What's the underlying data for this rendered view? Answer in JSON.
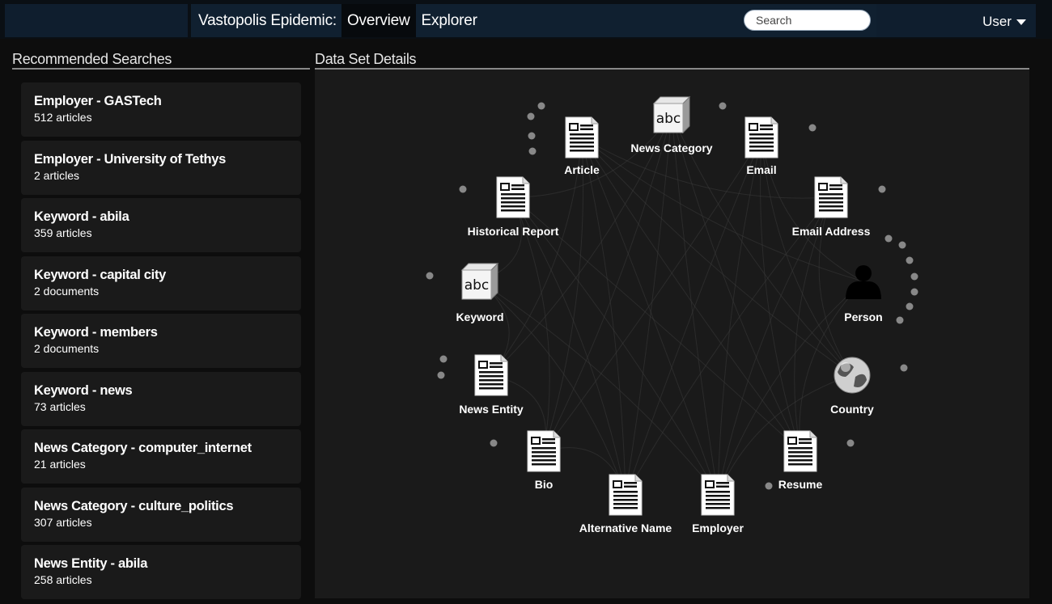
{
  "header": {
    "app_title": "Vastopolis Epidemic:",
    "tabs": [
      {
        "label": "Overview",
        "active": true
      },
      {
        "label": "Explorer",
        "active": false
      }
    ],
    "search_placeholder": "Search",
    "user_label": "User"
  },
  "left_panel": {
    "title": "Recommended Searches",
    "items": [
      {
        "title": "Employer - GASTech",
        "subtitle": "512 articles"
      },
      {
        "title": "Employer - University of Tethys",
        "subtitle": "2 articles"
      },
      {
        "title": "Keyword - abila",
        "subtitle": "359 articles"
      },
      {
        "title": "Keyword - capital city",
        "subtitle": "2 documents"
      },
      {
        "title": "Keyword - members",
        "subtitle": "2 documents"
      },
      {
        "title": "Keyword - news",
        "subtitle": "73 articles"
      },
      {
        "title": "News Category - computer_internet",
        "subtitle": "21 articles"
      },
      {
        "title": "News Category - culture_politics",
        "subtitle": "307 articles"
      },
      {
        "title": "News Entity - abila",
        "subtitle": "258 articles"
      }
    ]
  },
  "right_panel": {
    "title": "Data Set Details",
    "nodes": [
      {
        "label": "Article",
        "icon": "document-icon"
      },
      {
        "label": "News Category",
        "icon": "abc-cube-icon"
      },
      {
        "label": "Email",
        "icon": "document-icon"
      },
      {
        "label": "Historical Report",
        "icon": "document-icon"
      },
      {
        "label": "Email Address",
        "icon": "document-icon"
      },
      {
        "label": "Keyword",
        "icon": "abc-cube-icon"
      },
      {
        "label": "Person",
        "icon": "person-icon"
      },
      {
        "label": "News Entity",
        "icon": "document-icon"
      },
      {
        "label": "Country",
        "icon": "globe-icon"
      },
      {
        "label": "Bio",
        "icon": "document-icon"
      },
      {
        "label": "Resume",
        "icon": "document-icon"
      },
      {
        "label": "Alternative Name",
        "icon": "document-icon"
      },
      {
        "label": "Employer",
        "icon": "document-icon"
      }
    ],
    "cube_text": "abc"
  },
  "colors": {
    "topbar": "#0f1e2e",
    "panel": "#1a1a1a",
    "background": "#0d0d0d"
  }
}
